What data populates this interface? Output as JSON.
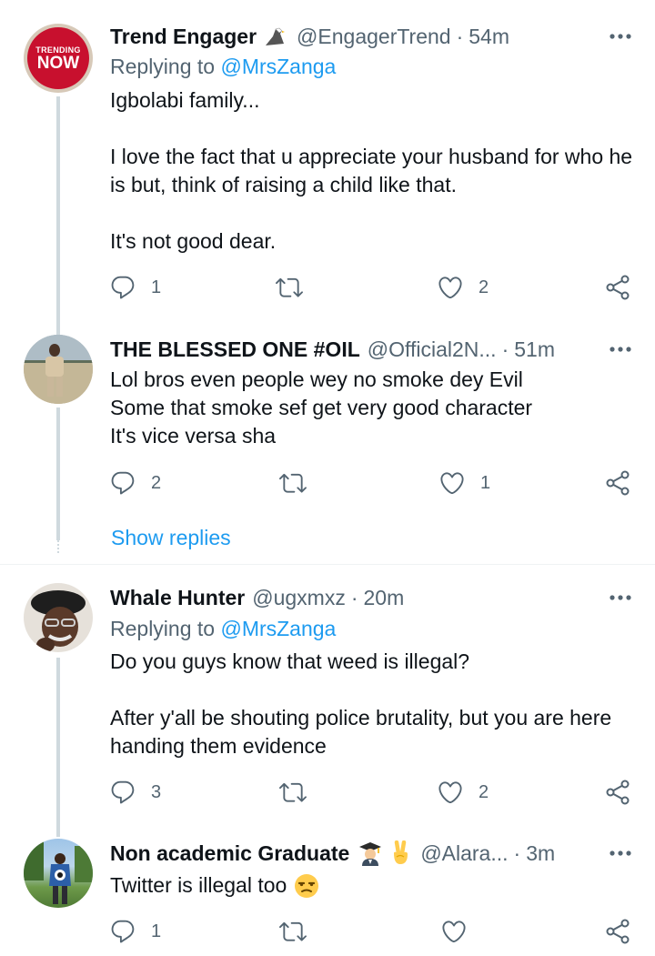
{
  "colors": {
    "accent": "#1d9bf0",
    "secondary_text": "#536471",
    "primary_text": "#0f1419",
    "thread_line": "#cfd9de"
  },
  "tweets": [
    {
      "name": "Trend Engager",
      "handle": "@EngagerTrend",
      "time": "54m",
      "name_emoji": "eagle",
      "avatar_text_top": "TRENDING",
      "avatar_text_bottom": "NOW",
      "replying_label": "Replying to",
      "replying_to": "@MrsZanga",
      "text": "Igbolabi family...\n\nI love the fact that u appreciate your husband for who he is but, think of raising a child like that.\n\nIt's not good dear.",
      "replies": "1",
      "retweets": "",
      "likes": "2"
    },
    {
      "name": "THE BLESSED ONE #OIL",
      "handle": "@Official2N...",
      "time": "51m",
      "text": "Lol bros even people wey no smoke dey Evil\nSome that smoke sef get very good character\nIt's vice versa sha",
      "replies": "2",
      "retweets": "",
      "likes": "1"
    },
    {
      "name": "Whale Hunter",
      "handle": "@ugxmxz",
      "time": "20m",
      "replying_label": "Replying to",
      "replying_to": "@MrsZanga",
      "text": "Do you guys know that weed is illegal?\n\nAfter y'all be shouting police brutality, but you are here handing them evidence",
      "replies": "3",
      "retweets": "",
      "likes": "2"
    },
    {
      "name": "Non academic Graduate",
      "handle": "@Alara...",
      "time": "3m",
      "name_emojis": [
        "graduate",
        "victory-hand"
      ],
      "text": "Twitter is illegal too",
      "text_emoji": "unamused-face",
      "replies": "1",
      "retweets": "",
      "likes": ""
    }
  ],
  "show_replies_label": "Show replies",
  "separator": "·"
}
